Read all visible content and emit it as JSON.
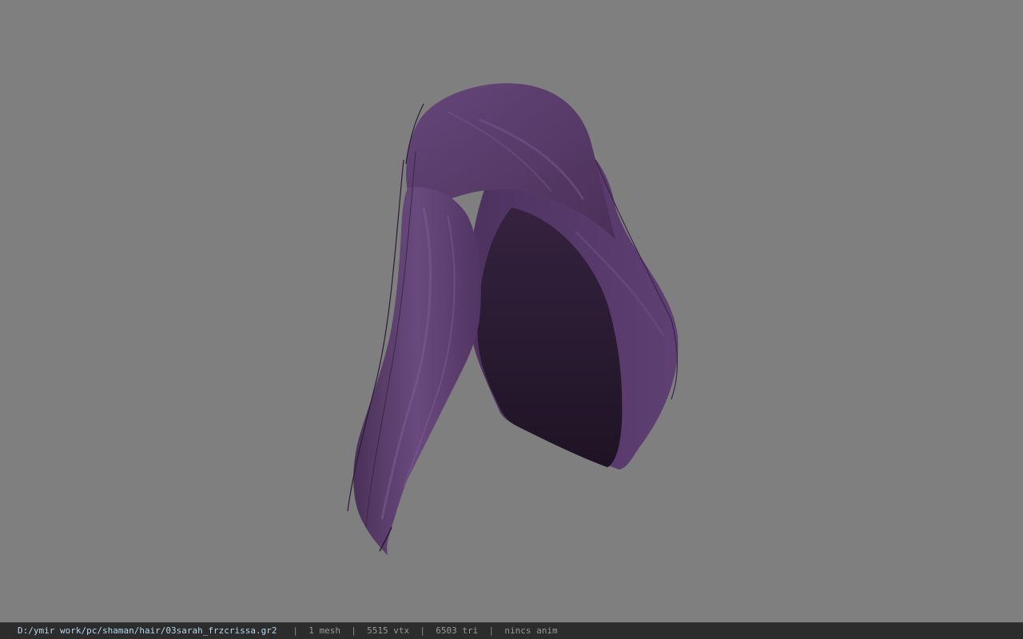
{
  "viewport": {
    "background_color": "#7f7f7f",
    "model": "hair mesh",
    "hair_color": "#5a3c6c"
  },
  "statusbar": {
    "file_path": "D:/ymir work/pc/shaman/hair/03sarah_frzcrissa.gr2",
    "separator": "|",
    "mesh_count": "1 mesh",
    "vertex_count": "5515 vtx",
    "triangle_count": "6503 tri",
    "anim_status": "nincs anim"
  }
}
